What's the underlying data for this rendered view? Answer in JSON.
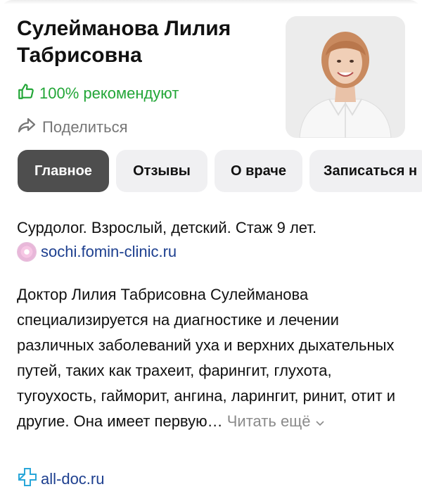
{
  "doctor": {
    "name_line1": "Сулейманова Лилия",
    "name_line2": "Табрисовна"
  },
  "recommend": {
    "text": "100% рекомендуют",
    "icon": "thumbs-up-icon",
    "color": "#22a637"
  },
  "share": {
    "label": "Поделиться",
    "icon": "share-icon"
  },
  "tabs": [
    {
      "label": "Главное",
      "active": true
    },
    {
      "label": "Отзывы",
      "active": false
    },
    {
      "label": "О враче",
      "active": false
    },
    {
      "label": "Записаться н",
      "active": false
    }
  ],
  "info": {
    "specialty": "Сурдолог. Взрослый, детский. Стаж 9 лет.",
    "site_link": "sochi.fomin-clinic.ru"
  },
  "description": {
    "text": "Доктор Лилия Табрисовна Сулейманова специализируется на диагностике и лечении различных заболеваний уха и верхних дыхательных путей, таких как трахеит, фарингит, глухота, тугоухость, гайморит, ангина, ларингит, ринит, отит и другие. Она имеет первую…",
    "read_more": "Читать ещё"
  },
  "source": {
    "link": "all-doc.ru",
    "icon": "medical-cross-icon"
  }
}
